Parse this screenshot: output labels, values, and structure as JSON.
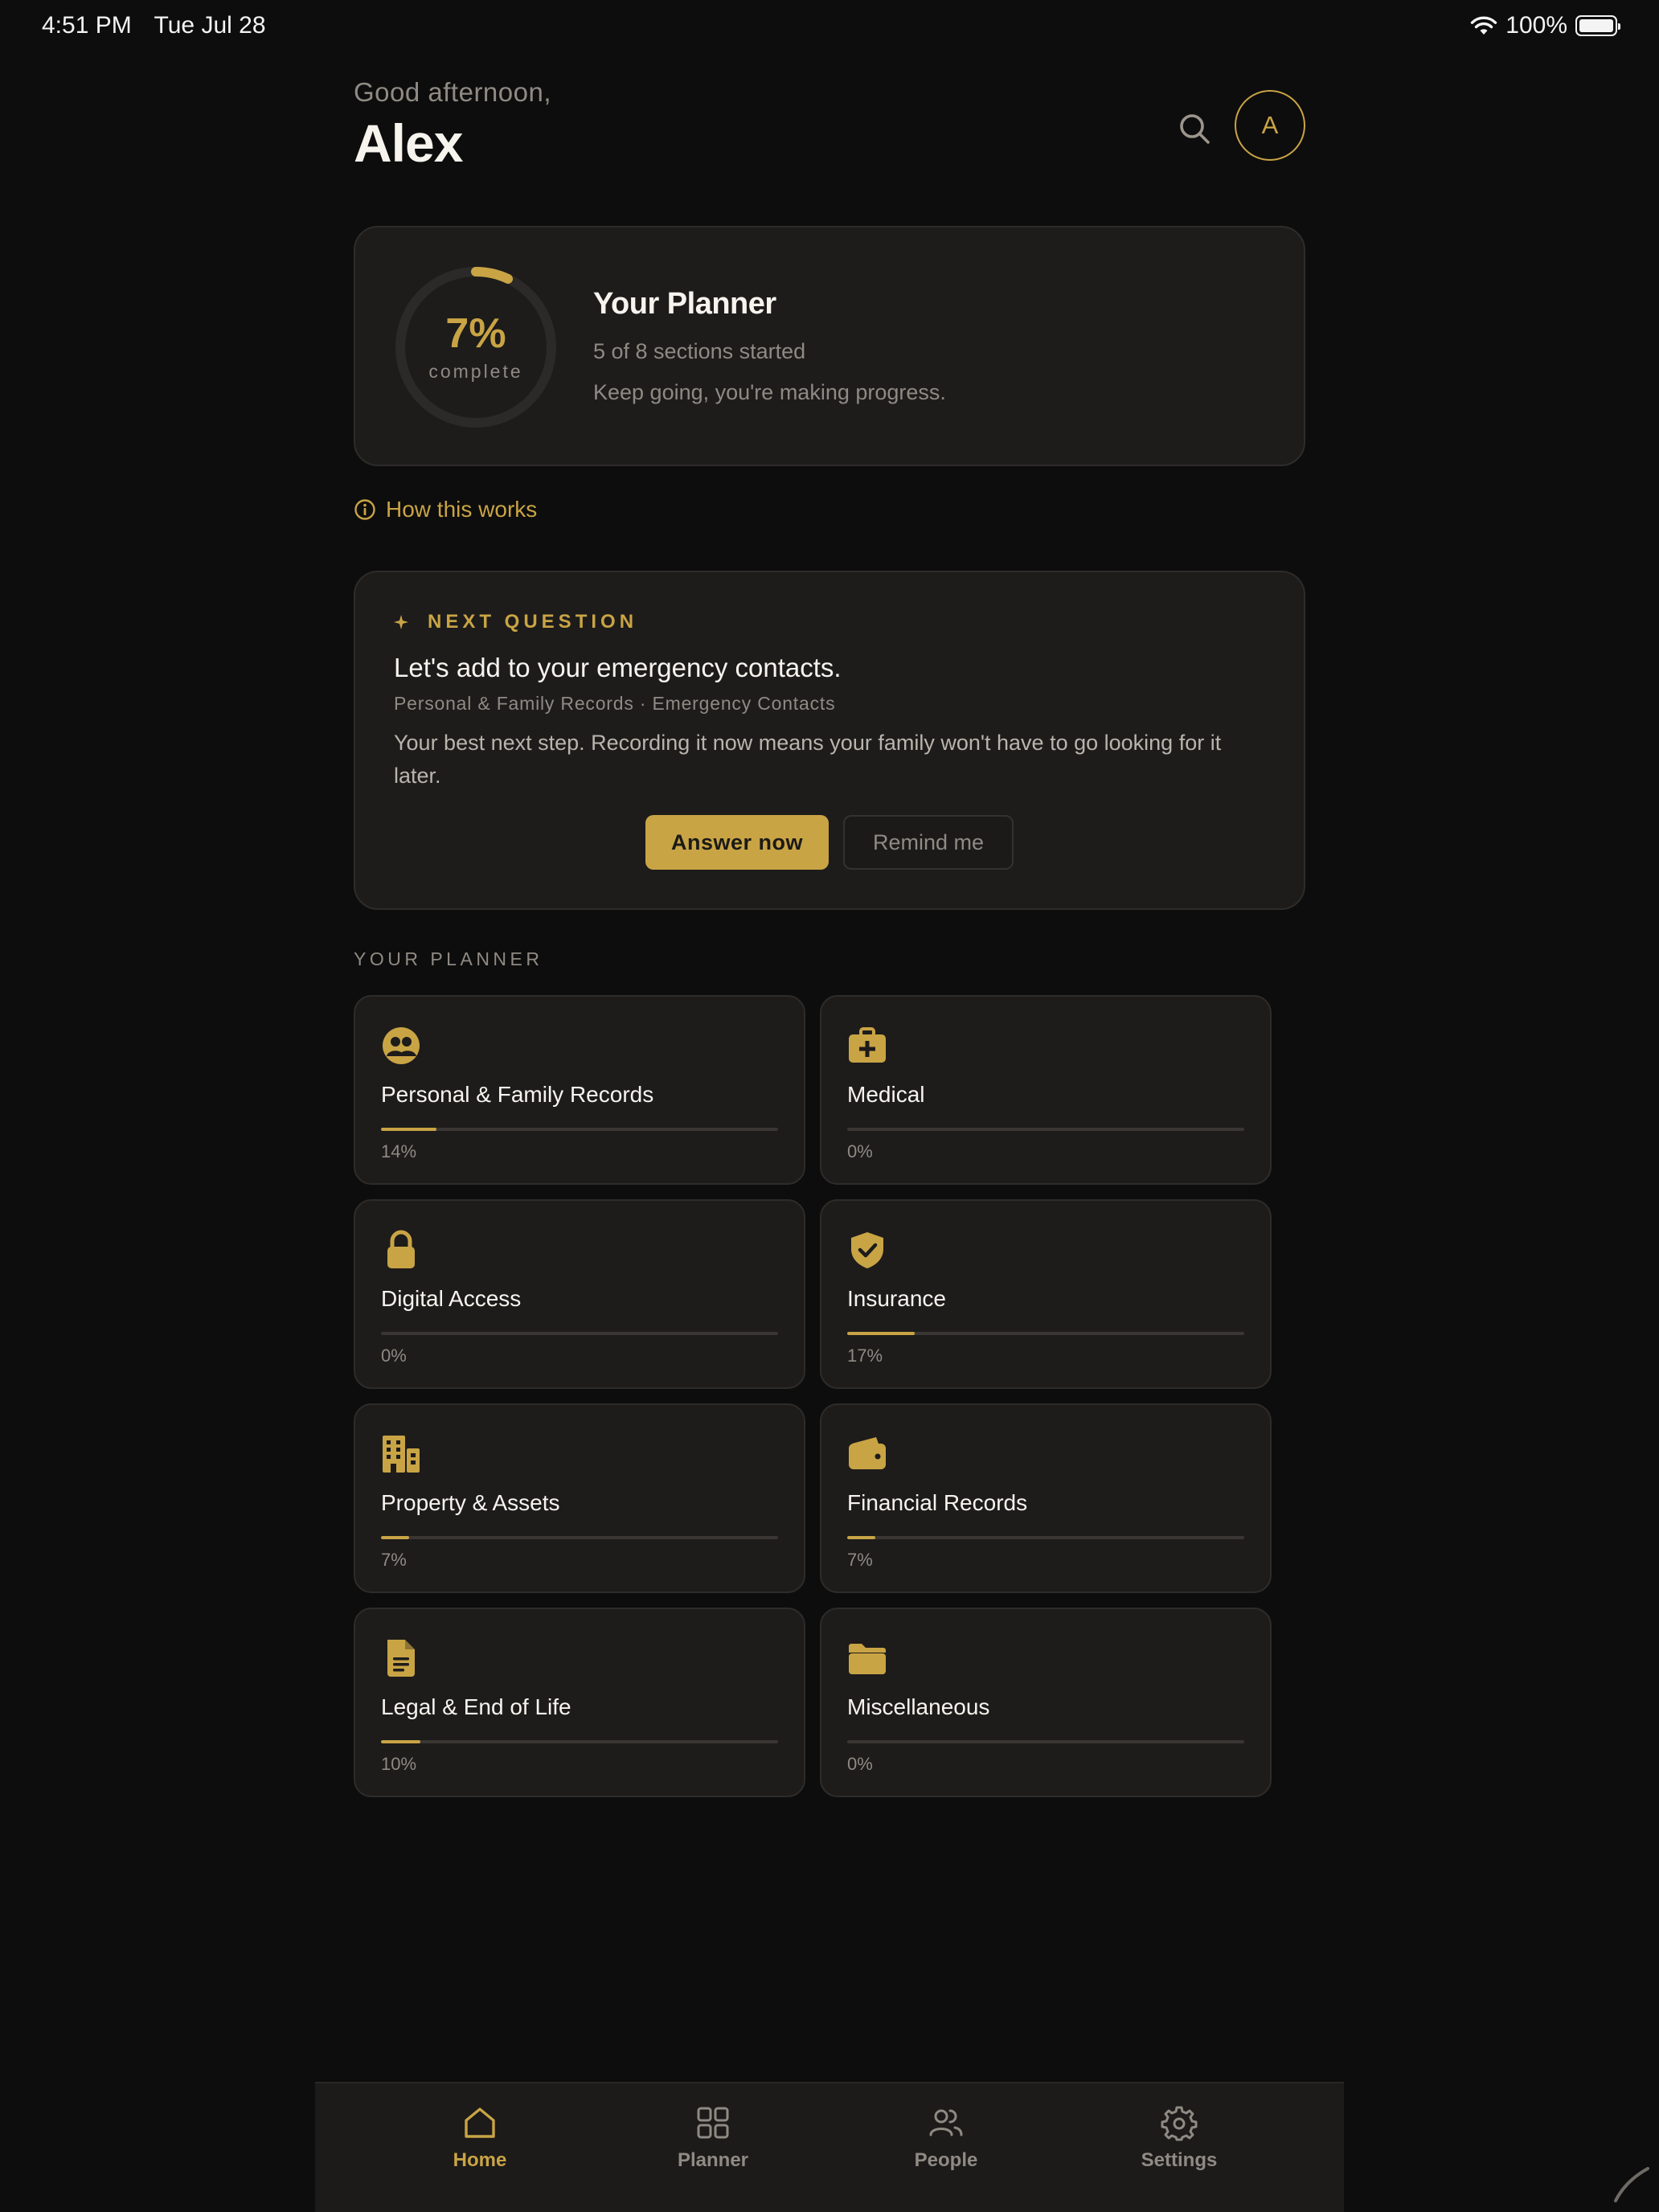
{
  "status_bar": {
    "time": "4:51 PM",
    "date": "Tue Jul 28",
    "battery": "100%"
  },
  "header": {
    "greeting": "Good afternoon,",
    "name": "Alex",
    "avatar_initial": "A"
  },
  "planner_summary": {
    "progress_value": 7,
    "percent": "7%",
    "percent_label": "complete",
    "title": "Your Planner",
    "subtitle": "5 of 8 sections started",
    "encouragement": "Keep going, you're making progress."
  },
  "how_link": {
    "label": "How this works"
  },
  "next_question": {
    "eyebrow": "NEXT QUESTION",
    "title": "Let's add to your emergency contacts.",
    "path": "Personal & Family Records · Emergency Contacts",
    "description": "Your best next step. Recording it now means your family won't have to go looking for it later.",
    "primary_label": "Answer now",
    "secondary_label": "Remind me"
  },
  "sections": {
    "heading": "YOUR PLANNER",
    "items": [
      {
        "title": "Personal & Family Records",
        "percent": "14%",
        "progress": 0.14,
        "icon": "family-icon"
      },
      {
        "title": "Medical",
        "percent": "0%",
        "progress": 0,
        "icon": "medical-kit-icon"
      },
      {
        "title": "Digital Access",
        "percent": "0%",
        "progress": 0,
        "icon": "lock-icon"
      },
      {
        "title": "Insurance",
        "percent": "17%",
        "progress": 0.17,
        "icon": "shield-check-icon"
      },
      {
        "title": "Property & Assets",
        "percent": "7%",
        "progress": 0.07,
        "icon": "building-icon"
      },
      {
        "title": "Financial Records",
        "percent": "7%",
        "progress": 0.07,
        "icon": "wallet-icon"
      },
      {
        "title": "Legal & End of Life",
        "percent": "10%",
        "progress": 0.1,
        "icon": "document-icon"
      },
      {
        "title": "Miscellaneous",
        "percent": "0%",
        "progress": 0,
        "icon": "folder-icon"
      }
    ]
  },
  "tabs": [
    {
      "label": "Home",
      "icon": "home-icon",
      "active": true
    },
    {
      "label": "Planner",
      "icon": "grid-icon",
      "active": false
    },
    {
      "label": "People",
      "icon": "people-icon",
      "active": false
    },
    {
      "label": "Settings",
      "icon": "gear-icon",
      "active": false
    }
  ],
  "colors": {
    "accent": "#c9a445",
    "background": "#0e0d0d",
    "card": "#1d1c1b",
    "muted": "#8f8a83"
  }
}
